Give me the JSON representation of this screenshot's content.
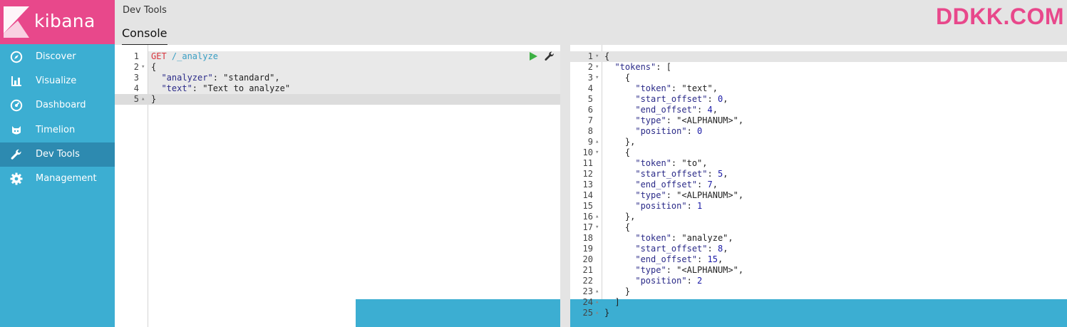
{
  "app": {
    "name": "kibana"
  },
  "sidebar": {
    "items": [
      {
        "label": "Discover",
        "icon": "compass-icon"
      },
      {
        "label": "Visualize",
        "icon": "bar-chart-icon"
      },
      {
        "label": "Dashboard",
        "icon": "dashboard-icon"
      },
      {
        "label": "Timelion",
        "icon": "timelion-icon"
      },
      {
        "label": "Dev Tools",
        "icon": "wrench-icon",
        "active": true
      },
      {
        "label": "Management",
        "icon": "gear-icon"
      }
    ]
  },
  "header": {
    "breadcrumb": "Dev Tools",
    "tab": "Console",
    "watermark": "DDKK.COM"
  },
  "colors": {
    "brand": "#e8488b",
    "sidebar": "#3caed2",
    "sidebar_active": "#2d8ab0",
    "run": "#3cb043"
  },
  "request_editor": {
    "lines": [
      {
        "n": "1",
        "fold": "",
        "segments": [
          {
            "t": "GET",
            "c": "method"
          },
          {
            "t": " /_analyze",
            "c": "url"
          }
        ]
      },
      {
        "n": "2",
        "fold": "▾",
        "segments": [
          {
            "t": "{",
            "c": "str"
          }
        ]
      },
      {
        "n": "3",
        "fold": "",
        "segments": [
          {
            "t": "  \"analyzer\"",
            "c": "key"
          },
          {
            "t": ": \"standard\",",
            "c": "str"
          }
        ]
      },
      {
        "n": "4",
        "fold": "",
        "segments": [
          {
            "t": "  \"text\"",
            "c": "key"
          },
          {
            "t": ": \"Text to analyze\"",
            "c": "str"
          }
        ]
      },
      {
        "n": "5",
        "fold": "▴",
        "segments": [
          {
            "t": "}",
            "c": "str"
          }
        ]
      }
    ]
  },
  "response_editor": {
    "lines": [
      {
        "n": "1",
        "fold": "▾",
        "segments": [
          {
            "t": "{",
            "c": "str"
          }
        ]
      },
      {
        "n": "2",
        "fold": "▾",
        "segments": [
          {
            "t": "  \"tokens\"",
            "c": "key"
          },
          {
            "t": ": [",
            "c": "str"
          }
        ]
      },
      {
        "n": "3",
        "fold": "▾",
        "segments": [
          {
            "t": "    {",
            "c": "str"
          }
        ]
      },
      {
        "n": "4",
        "fold": "",
        "segments": [
          {
            "t": "      \"token\"",
            "c": "key"
          },
          {
            "t": ": \"text\",",
            "c": "str"
          }
        ]
      },
      {
        "n": "5",
        "fold": "",
        "segments": [
          {
            "t": "      \"start_offset\"",
            "c": "key"
          },
          {
            "t": ": ",
            "c": "str"
          },
          {
            "t": "0",
            "c": "numv"
          },
          {
            "t": ",",
            "c": "str"
          }
        ]
      },
      {
        "n": "6",
        "fold": "",
        "segments": [
          {
            "t": "      \"end_offset\"",
            "c": "key"
          },
          {
            "t": ": ",
            "c": "str"
          },
          {
            "t": "4",
            "c": "numv"
          },
          {
            "t": ",",
            "c": "str"
          }
        ]
      },
      {
        "n": "7",
        "fold": "",
        "segments": [
          {
            "t": "      \"type\"",
            "c": "key"
          },
          {
            "t": ": \"<ALPHANUM>\",",
            "c": "str"
          }
        ]
      },
      {
        "n": "8",
        "fold": "",
        "segments": [
          {
            "t": "      \"position\"",
            "c": "key"
          },
          {
            "t": ": ",
            "c": "str"
          },
          {
            "t": "0",
            "c": "numv"
          }
        ]
      },
      {
        "n": "9",
        "fold": "▴",
        "segments": [
          {
            "t": "    },",
            "c": "str"
          }
        ]
      },
      {
        "n": "10",
        "fold": "▾",
        "segments": [
          {
            "t": "    {",
            "c": "str"
          }
        ]
      },
      {
        "n": "11",
        "fold": "",
        "segments": [
          {
            "t": "      \"token\"",
            "c": "key"
          },
          {
            "t": ": \"to\",",
            "c": "str"
          }
        ]
      },
      {
        "n": "12",
        "fold": "",
        "segments": [
          {
            "t": "      \"start_offset\"",
            "c": "key"
          },
          {
            "t": ": ",
            "c": "str"
          },
          {
            "t": "5",
            "c": "numv"
          },
          {
            "t": ",",
            "c": "str"
          }
        ]
      },
      {
        "n": "13",
        "fold": "",
        "segments": [
          {
            "t": "      \"end_offset\"",
            "c": "key"
          },
          {
            "t": ": ",
            "c": "str"
          },
          {
            "t": "7",
            "c": "numv"
          },
          {
            "t": ",",
            "c": "str"
          }
        ]
      },
      {
        "n": "14",
        "fold": "",
        "segments": [
          {
            "t": "      \"type\"",
            "c": "key"
          },
          {
            "t": ": \"<ALPHANUM>\",",
            "c": "str"
          }
        ]
      },
      {
        "n": "15",
        "fold": "",
        "segments": [
          {
            "t": "      \"position\"",
            "c": "key"
          },
          {
            "t": ": ",
            "c": "str"
          },
          {
            "t": "1",
            "c": "numv"
          }
        ]
      },
      {
        "n": "16",
        "fold": "▴",
        "segments": [
          {
            "t": "    },",
            "c": "str"
          }
        ]
      },
      {
        "n": "17",
        "fold": "▾",
        "segments": [
          {
            "t": "    {",
            "c": "str"
          }
        ]
      },
      {
        "n": "18",
        "fold": "",
        "segments": [
          {
            "t": "      \"token\"",
            "c": "key"
          },
          {
            "t": ": \"analyze\",",
            "c": "str"
          }
        ]
      },
      {
        "n": "19",
        "fold": "",
        "segments": [
          {
            "t": "      \"start_offset\"",
            "c": "key"
          },
          {
            "t": ": ",
            "c": "str"
          },
          {
            "t": "8",
            "c": "numv"
          },
          {
            "t": ",",
            "c": "str"
          }
        ]
      },
      {
        "n": "20",
        "fold": "",
        "segments": [
          {
            "t": "      \"end_offset\"",
            "c": "key"
          },
          {
            "t": ": ",
            "c": "str"
          },
          {
            "t": "15",
            "c": "numv"
          },
          {
            "t": ",",
            "c": "str"
          }
        ]
      },
      {
        "n": "21",
        "fold": "",
        "segments": [
          {
            "t": "      \"type\"",
            "c": "key"
          },
          {
            "t": ": \"<ALPHANUM>\",",
            "c": "str"
          }
        ]
      },
      {
        "n": "22",
        "fold": "",
        "segments": [
          {
            "t": "      \"position\"",
            "c": "key"
          },
          {
            "t": ": ",
            "c": "str"
          },
          {
            "t": "2",
            "c": "numv"
          }
        ]
      },
      {
        "n": "23",
        "fold": "▴",
        "segments": [
          {
            "t": "    }",
            "c": "str"
          }
        ]
      },
      {
        "n": "24",
        "fold": "▴",
        "segments": [
          {
            "t": "  ]",
            "c": "str"
          }
        ]
      },
      {
        "n": "25",
        "fold": "▴",
        "segments": [
          {
            "t": "}",
            "c": "str"
          }
        ]
      }
    ]
  }
}
